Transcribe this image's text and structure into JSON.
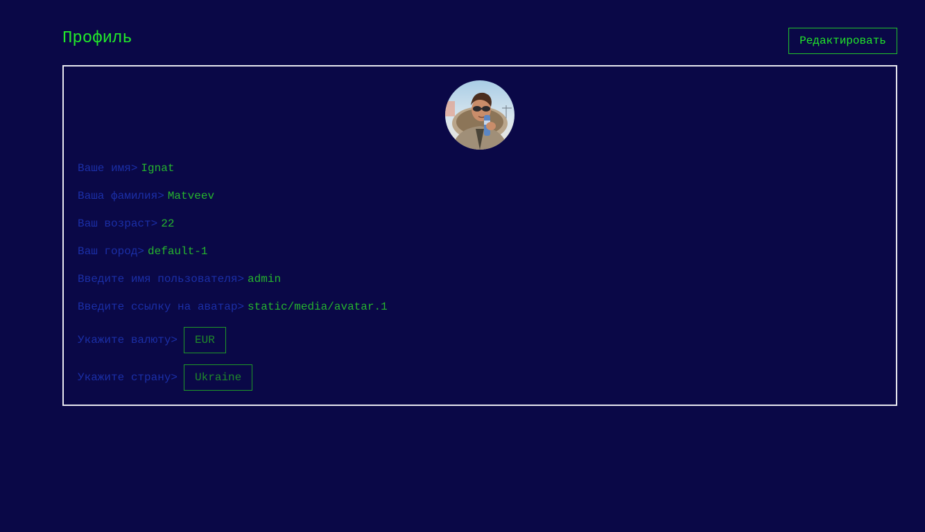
{
  "header": {
    "title": "Профиль",
    "edit_label": "Редактировать"
  },
  "profile": {
    "avatar_icon": "user-photo-avatar",
    "fields": [
      {
        "label": "Ваше имя>",
        "value": "Ignat"
      },
      {
        "label": "Ваша фамилия>",
        "value": "Matveev"
      },
      {
        "label": "Ваш возраст>",
        "value": "22"
      },
      {
        "label": "Ваш город>",
        "value": "default-1"
      },
      {
        "label": "Введите имя пользователя>",
        "value": "admin"
      },
      {
        "label": "Введите ссылку на аватар>",
        "value": "static/media/avatar.1"
      }
    ],
    "currency": {
      "label": "Укажите валюту>",
      "value": "EUR"
    },
    "country": {
      "label": "Укажите страну>",
      "value": "Ukraine"
    }
  },
  "colors": {
    "background": "#0a0847",
    "accent_green": "#22e82a",
    "label_blue": "#1b2fa8",
    "value_green": "#26b52e",
    "card_border": "#e8e8f0"
  }
}
